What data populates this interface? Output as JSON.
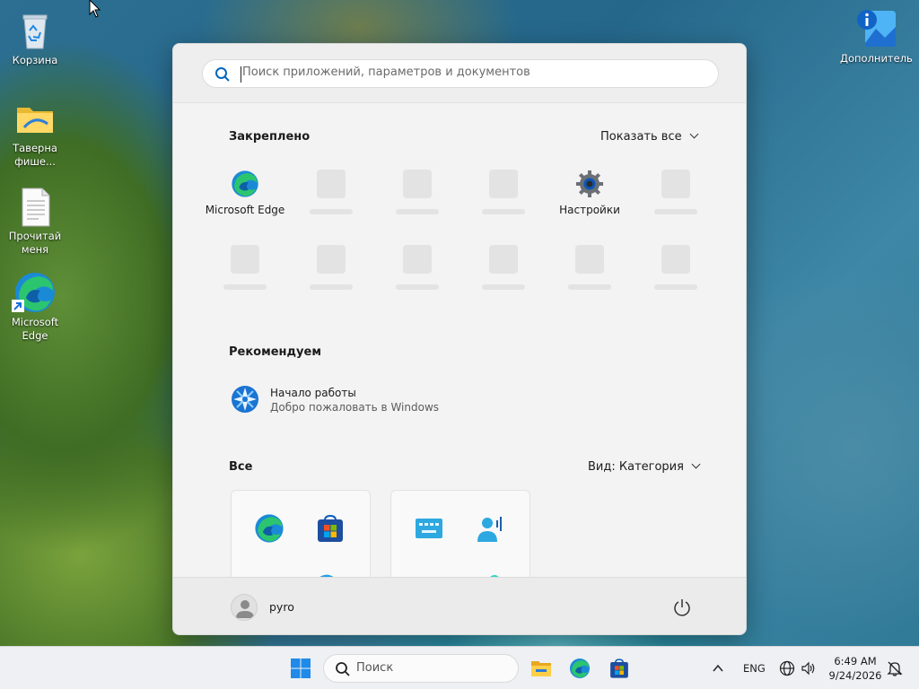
{
  "desktop": {
    "icons": [
      {
        "label": "Корзина",
        "icon": "recycle-bin-icon"
      },
      {
        "label": "Таверна фише...",
        "icon": "folder-icon"
      },
      {
        "label": "Прочитай меня",
        "icon": "text-document-icon"
      },
      {
        "label": "Microsoft Edge",
        "icon": "edge-icon"
      },
      {
        "label": "Дополнительные сведения о...",
        "icon": "learn-about-picture-icon"
      }
    ]
  },
  "start_menu": {
    "search": {
      "placeholder": "Поиск приложений, параметров и документов"
    },
    "pinned": {
      "title": "Закреплено",
      "show_all": "Показать все",
      "apps": [
        {
          "label": "Microsoft Edge",
          "icon": "edge-icon"
        },
        {
          "label": "Настройки",
          "icon": "settings-gear-icon"
        }
      ]
    },
    "recommended": {
      "title": "Рекомендуем",
      "items": [
        {
          "title": "Начало работы",
          "subtitle": "Добро пожаловать в Windows",
          "icon": "get-started-icon"
        }
      ]
    },
    "all": {
      "title": "Все",
      "view_label": "Вид: Категория"
    },
    "user": {
      "name": "pyro"
    },
    "power": {
      "icon": "power-icon"
    }
  },
  "taskbar": {
    "search_label": "Поиск",
    "apps": [
      "file-explorer-icon",
      "edge-icon",
      "store-icon"
    ],
    "tray": {
      "language": "ENG",
      "time": "6:49 AM",
      "date": "9/24/2026"
    }
  },
  "colors": {
    "accent": "#0067c0",
    "start_bg": "#f3f3f3",
    "taskbar_bg": "#eef0f3"
  }
}
